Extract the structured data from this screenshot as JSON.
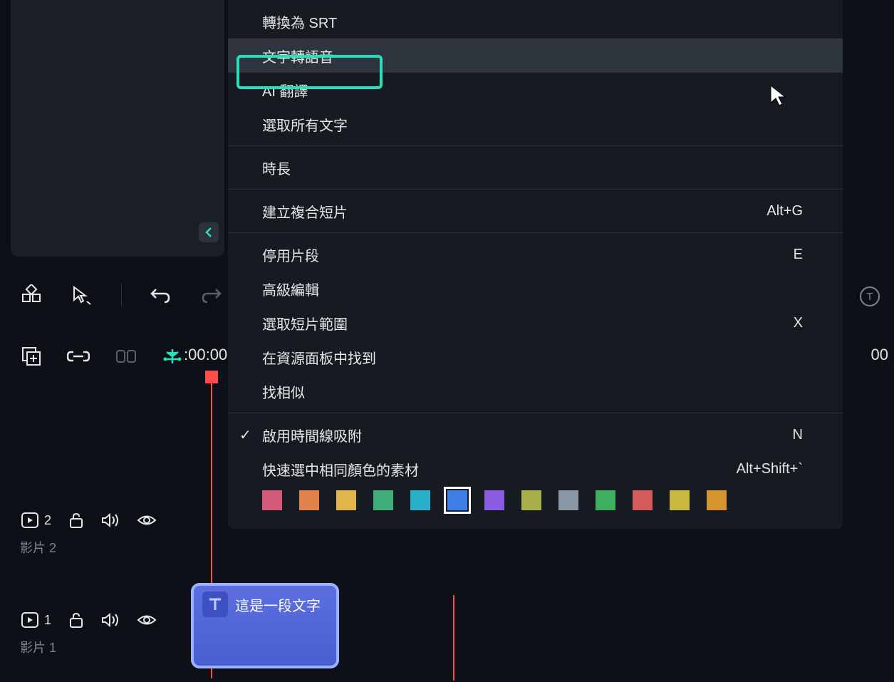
{
  "menu": {
    "groups": [
      {
        "items": [
          {
            "label": "轉換為 SRT",
            "shortcut": ""
          },
          {
            "label": "文字轉語音",
            "shortcut": "",
            "highlighted": true
          },
          {
            "label": "AI 翻譯",
            "shortcut": ""
          },
          {
            "label": "選取所有文字",
            "shortcut": ""
          }
        ]
      },
      {
        "items": [
          {
            "label": "時長",
            "shortcut": ""
          }
        ]
      },
      {
        "items": [
          {
            "label": "建立複合短片",
            "shortcut": "Alt+G"
          }
        ]
      },
      {
        "items": [
          {
            "label": "停用片段",
            "shortcut": "E"
          },
          {
            "label": "高級編輯",
            "shortcut": ""
          },
          {
            "label": "選取短片範圍",
            "shortcut": "X"
          },
          {
            "label": "在資源面板中找到",
            "shortcut": ""
          },
          {
            "label": "找相似",
            "shortcut": ""
          }
        ]
      },
      {
        "items": [
          {
            "label": "啟用時間線吸附",
            "shortcut": "N",
            "checked": true
          },
          {
            "label": "快速選中相同顏色的素材",
            "shortcut": "Alt+Shift+`"
          }
        ]
      }
    ]
  },
  "colors": [
    "#d45b78",
    "#e08249",
    "#e0b64c",
    "#3fae7b",
    "#29b0c8",
    "#3d7fe6",
    "#8a5de0",
    "#a8b04c",
    "#8a98a6",
    "#3fae5e",
    "#d45b5b",
    "#c8b83f",
    "#d6942f"
  ],
  "selected_color_index": 5,
  "time_left": ":00:00",
  "time_right": "00",
  "tracks": {
    "track1": {
      "num": "2",
      "label": "影片 2"
    },
    "track2": {
      "num": "1",
      "label": "影片 1"
    }
  },
  "clip": {
    "label": "這是一段文字"
  },
  "circle_label": "T"
}
